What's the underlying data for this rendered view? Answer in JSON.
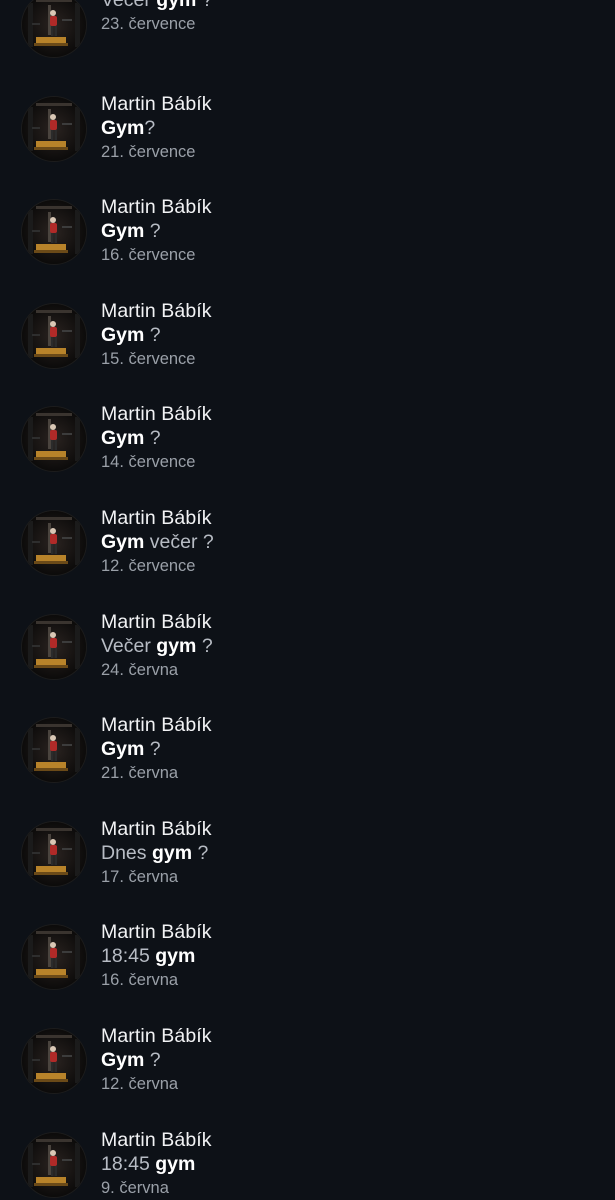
{
  "results": [
    {
      "sender": "",
      "preview": [
        {
          "text": "Večer ",
          "bold": false
        },
        {
          "text": "gym",
          "bold": true
        },
        {
          "text": " ?",
          "bold": false
        }
      ],
      "date": "23. července"
    },
    {
      "sender": "Martin Bábík",
      "preview": [
        {
          "text": "Gym",
          "bold": true
        },
        {
          "text": "?",
          "bold": false
        }
      ],
      "date": "21. července"
    },
    {
      "sender": "Martin Bábík",
      "preview": [
        {
          "text": "Gym",
          "bold": true
        },
        {
          "text": " ?",
          "bold": false
        }
      ],
      "date": "16. července"
    },
    {
      "sender": "Martin Bábík",
      "preview": [
        {
          "text": "Gym",
          "bold": true
        },
        {
          "text": " ?",
          "bold": false
        }
      ],
      "date": "15. července"
    },
    {
      "sender": "Martin Bábík",
      "preview": [
        {
          "text": "Gym",
          "bold": true
        },
        {
          "text": " ?",
          "bold": false
        }
      ],
      "date": "14. července"
    },
    {
      "sender": "Martin Bábík",
      "preview": [
        {
          "text": "Gym",
          "bold": true
        },
        {
          "text": " večer ?",
          "bold": false
        }
      ],
      "date": "12. července"
    },
    {
      "sender": "Martin Bábík",
      "preview": [
        {
          "text": "Večer ",
          "bold": false
        },
        {
          "text": "gym",
          "bold": true
        },
        {
          "text": " ?",
          "bold": false
        }
      ],
      "date": "24. června"
    },
    {
      "sender": "Martin Bábík",
      "preview": [
        {
          "text": "Gym",
          "bold": true
        },
        {
          "text": " ?",
          "bold": false
        }
      ],
      "date": "21. června"
    },
    {
      "sender": "Martin Bábík",
      "preview": [
        {
          "text": "Dnes ",
          "bold": false
        },
        {
          "text": "gym",
          "bold": true
        },
        {
          "text": " ?",
          "bold": false
        }
      ],
      "date": "17. června"
    },
    {
      "sender": "Martin Bábík",
      "preview": [
        {
          "text": "18:45 ",
          "bold": false
        },
        {
          "text": "gym",
          "bold": true
        }
      ],
      "date": "16. června"
    },
    {
      "sender": "Martin Bábík",
      "preview": [
        {
          "text": "Gym",
          "bold": true
        },
        {
          "text": " ?",
          "bold": false
        }
      ],
      "date": "12. června"
    },
    {
      "sender": "Martin Bábík",
      "preview": [
        {
          "text": "18:45 ",
          "bold": false
        },
        {
          "text": "gym",
          "bold": true
        }
      ],
      "date": "9. června"
    }
  ],
  "avatar_icon": "profile-photo-gym",
  "colors": {
    "background": "#0d1117",
    "sender": "#f2f3f5",
    "preview": "#b7bcc4",
    "highlight": "#ffffff",
    "date": "#9aa0a8"
  }
}
